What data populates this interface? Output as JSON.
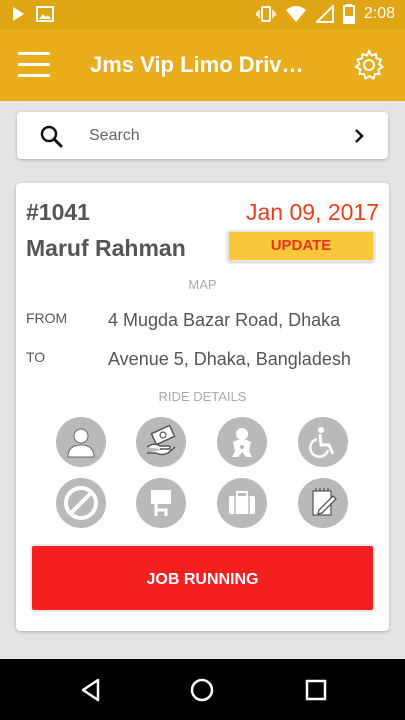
{
  "status_bar": {
    "time": "2:08",
    "icons": [
      "play-icon",
      "image-icon",
      "vibrate-icon",
      "wifi-icon",
      "signal-icon",
      "battery-icon"
    ]
  },
  "app_bar": {
    "title": "Jms Vip Limo Driv…",
    "menu_icon": "menu-icon",
    "settings_icon": "gear-icon"
  },
  "search": {
    "placeholder": "Search"
  },
  "job": {
    "number": "#1041",
    "date": "Jan 09, 2017",
    "customer": "Maruf Rahman",
    "update_label": "UPDATE",
    "map_label": "MAP",
    "from_label": "FROM",
    "from_value": "4 Mugda Bazar Road, Dhaka",
    "to_label": "TO",
    "to_value": "Avenue 5, Dhaka, Bangladesh",
    "ride_details_label": "RIDE DETAILS",
    "ride_detail_icons": [
      "passenger-icon",
      "payment-icon",
      "child-seat-icon",
      "wheelchair-icon",
      "no-smoking-icon",
      "sign-board-icon",
      "luggage-icon",
      "notes-icon"
    ],
    "job_running_label": "JOB RUNNING"
  },
  "colors": {
    "app_bar": "#e9ac1b",
    "status_bar": "#e0a515",
    "date": "#e8411a",
    "update_button": "#f9c73a",
    "job_running": "#f42020",
    "detail_icon_bg": "#b9b9b9"
  }
}
